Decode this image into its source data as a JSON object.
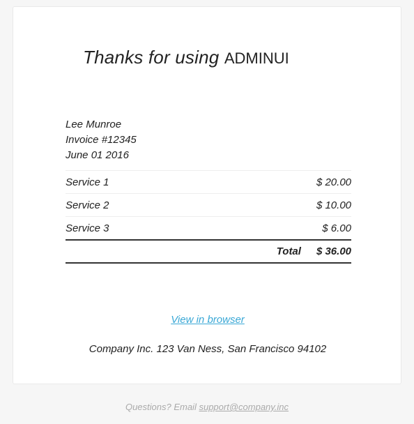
{
  "header": {
    "thanks_text": "Thanks for using",
    "brand": "ADMINUI"
  },
  "invoice": {
    "customer_name": "Lee Munroe",
    "invoice_number": "Invoice #12345",
    "date": "June 01 2016"
  },
  "items": [
    {
      "name": "Service 1",
      "amount": "$ 20.00"
    },
    {
      "name": "Service 2",
      "amount": "$ 10.00"
    },
    {
      "name": "Service 3",
      "amount": "$ 6.00"
    }
  ],
  "total": {
    "label": "Total",
    "amount": "$ 36.00"
  },
  "links": {
    "view_in_browser": "View in browser"
  },
  "company": {
    "address": "Company Inc. 123 Van Ness, San Francisco 94102"
  },
  "footer": {
    "questions_text": "Questions? Email",
    "email": "support@company.inc"
  },
  "colors": {
    "link": "#3aa8d6",
    "muted": "#aaaaaa"
  }
}
